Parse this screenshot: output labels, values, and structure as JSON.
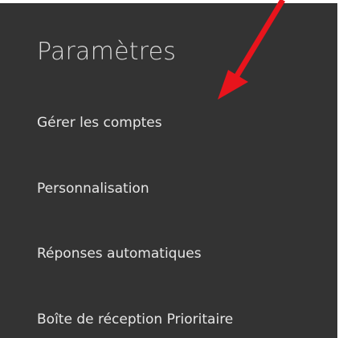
{
  "settings": {
    "title": "Paramètres",
    "items": [
      {
        "label": "Gérer les comptes"
      },
      {
        "label": "Personnalisation"
      },
      {
        "label": "Réponses automatiques"
      },
      {
        "label": "Boîte de réception Prioritaire"
      }
    ]
  },
  "colors": {
    "panel_background": "#333333",
    "text": "#e6e6e6",
    "annotation_arrow": "#e8141c"
  },
  "annotation": {
    "icon": "red-arrow-icon"
  }
}
